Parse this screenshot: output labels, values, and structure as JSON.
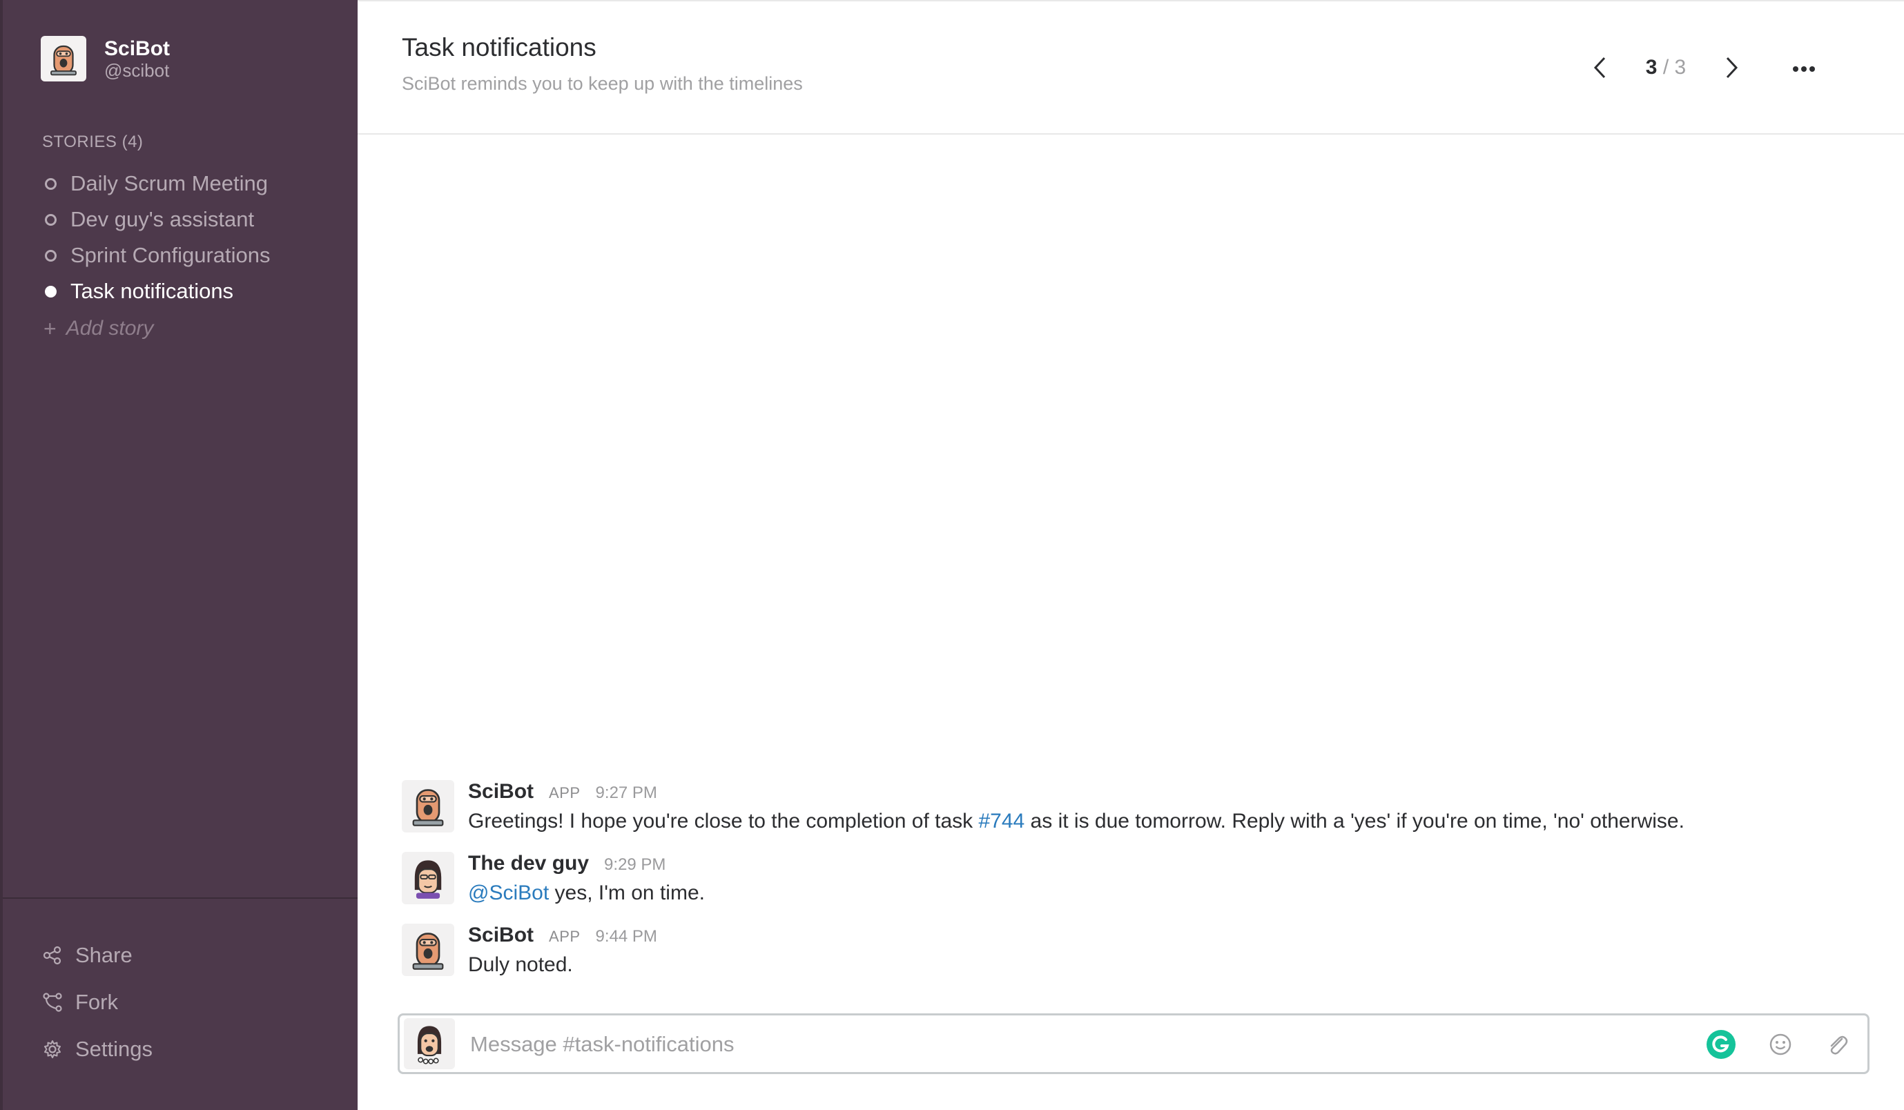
{
  "bot": {
    "name": "SciBot",
    "handle": "@scibot"
  },
  "stories": {
    "title": "STORIES (4)",
    "items": [
      {
        "label": "Daily Scrum Meeting"
      },
      {
        "label": "Dev guy's assistant"
      },
      {
        "label": "Sprint Configurations"
      },
      {
        "label": "Task notifications"
      }
    ],
    "add_label": "Add story"
  },
  "menu": {
    "share": "Share",
    "fork": "Fork",
    "settings": "Settings"
  },
  "header": {
    "title": "Task notifications",
    "subtitle": "SciBot reminds you to keep up with the timelines",
    "pager_current": "3",
    "pager_total": "/ 3"
  },
  "messages": [
    {
      "author": "SciBot",
      "badge": "APP",
      "time": "9:27 PM",
      "text_before": "Greetings! I hope you're close to the completion of task ",
      "link": "#744",
      "text_after": " as it is due tomorrow. Reply with a 'yes' if you're on time, 'no' otherwise."
    },
    {
      "author": "The dev guy",
      "time": "9:29 PM",
      "mention": "@SciBot",
      "text_after": " yes, I'm on time."
    },
    {
      "author": "SciBot",
      "badge": "APP",
      "time": "9:44 PM",
      "text": "Duly noted."
    }
  ],
  "composer": {
    "placeholder": "Message #task-notifications"
  },
  "colors": {
    "sidebar": "#4d394b",
    "link": "#2a7bbd",
    "grammarly": "#15c39a"
  }
}
